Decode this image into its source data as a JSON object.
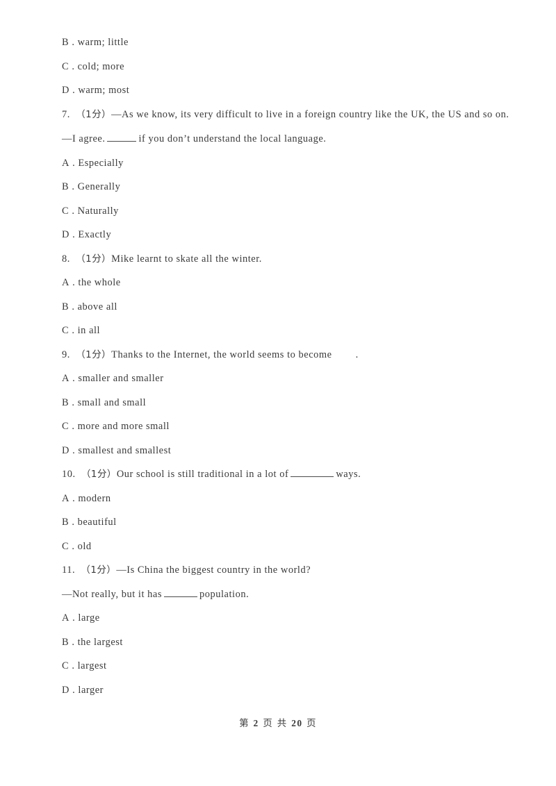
{
  "document": {
    "type": "exam-paper",
    "language": "en-zh",
    "background_color": "#ffffff",
    "text_color": "#3a3a3a"
  },
  "orphan_options": [
    {
      "letter": "B",
      "sep": ".",
      "text": "warm; little"
    },
    {
      "letter": "C",
      "sep": ".",
      "text": "cold; more"
    },
    {
      "letter": "D",
      "sep": ".",
      "text": "warm; most"
    }
  ],
  "questions": [
    {
      "number": "7.",
      "marks": "（1分）",
      "stem": "—As we know, its very difficult to live in a foreign country like the UK, the US and so on.",
      "stem2_prefix": "—I agree.",
      "stem2_suffix": "if you don’t understand the local language.",
      "options": [
        {
          "letter": "A",
          "sep": ".",
          "text": "Especially"
        },
        {
          "letter": "B",
          "sep": ".",
          "text": "Generally"
        },
        {
          "letter": "C",
          "sep": ".",
          "text": "Naturally"
        },
        {
          "letter": "D",
          "sep": ".",
          "text": "Exactly"
        }
      ]
    },
    {
      "number": "8.",
      "marks": "（1分）",
      "stem": "Mike learnt to skate all the winter.",
      "options": [
        {
          "letter": "A",
          "sep": ".",
          "text": "the whole"
        },
        {
          "letter": "B",
          "sep": ".",
          "text": "above all"
        },
        {
          "letter": "C",
          "sep": ".",
          "text": "in all"
        }
      ]
    },
    {
      "number": "9.",
      "marks": "（1分）",
      "stem_prefix": "Thanks to the Internet, the world seems to become",
      "stem_suffix": ".",
      "options": [
        {
          "letter": "A",
          "sep": ".",
          "text": "smaller and smaller"
        },
        {
          "letter": "B",
          "sep": ".",
          "text": "small and small"
        },
        {
          "letter": "C",
          "sep": ".",
          "text": "more and more small"
        },
        {
          "letter": "D",
          "sep": ".",
          "text": "smallest and smallest"
        }
      ]
    },
    {
      "number": "10.",
      "marks": "（1分）",
      "stem_prefix": "Our school is still traditional in a lot of",
      "stem_suffix": "ways.",
      "options": [
        {
          "letter": "A",
          "sep": ".",
          "text": "modern"
        },
        {
          "letter": "B",
          "sep": ".",
          "text": "beautiful"
        },
        {
          "letter": "C",
          "sep": ".",
          "text": "old"
        }
      ]
    },
    {
      "number": "11.",
      "marks": "（1分）",
      "stem": "—Is China the biggest country in the world?",
      "stem2_prefix": "—Not really, but it has",
      "stem2_suffix": "population.",
      "options": [
        {
          "letter": "A",
          "sep": ".",
          "text": "large"
        },
        {
          "letter": "B",
          "sep": ".",
          "text": "the largest"
        },
        {
          "letter": "C",
          "sep": ".",
          "text": "largest"
        },
        {
          "letter": "D",
          "sep": ".",
          "text": "larger"
        }
      ]
    }
  ],
  "footer": {
    "prefix": "第",
    "current_page": "2",
    "middle": "页 共",
    "total_pages": "20",
    "suffix": "页"
  }
}
